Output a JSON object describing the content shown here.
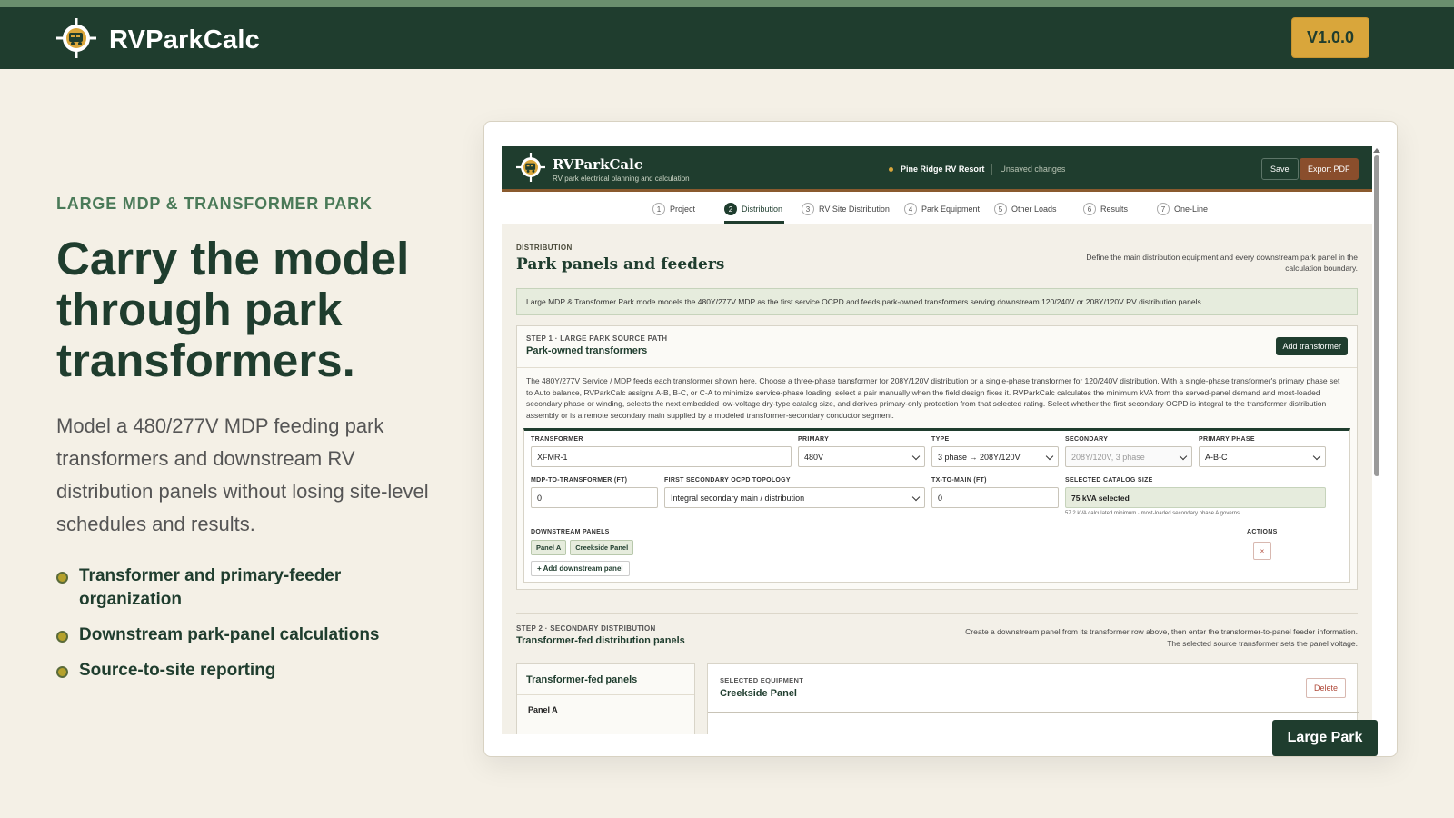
{
  "site": {
    "brand": "RVParkCalc",
    "version": "V1.0.0"
  },
  "hero": {
    "eyebrow": "LARGE MDP & TRANSFORMER PARK",
    "headline": "Carry the model through park transformers.",
    "description": "Model a 480/277V MDP feeding park transformers and downstream RV distribution panels without losing site-level schedules and results.",
    "bullets": [
      "Transformer and primary-feeder organization",
      "Downstream park-panel calculations",
      "Source-to-site reporting"
    ]
  },
  "app": {
    "title": "RVParkCalc",
    "subtitle": "RV park electrical planning and calculation",
    "project_name": "Pine Ridge RV Resort",
    "project_status": "Unsaved changes",
    "save_label": "Save",
    "export_label": "Export PDF",
    "tabs": [
      {
        "num": "1",
        "label": "Project"
      },
      {
        "num": "2",
        "label": "Distribution"
      },
      {
        "num": "3",
        "label": "RV Site Distribution"
      },
      {
        "num": "4",
        "label": "Park Equipment"
      },
      {
        "num": "5",
        "label": "Other Loads"
      },
      {
        "num": "6",
        "label": "Results"
      },
      {
        "num": "7",
        "label": "One-Line"
      }
    ],
    "section": {
      "eyebrow": "DISTRIBUTION",
      "title": "Park panels and feeders",
      "description": "Define the main distribution equipment and every downstream park panel in the calculation boundary.",
      "notice": "Large MDP & Transformer Park mode models the 480Y/277V MDP as the first service OCPD and feeds park-owned transformers serving downstream 120/240V or 208Y/120V RV distribution panels."
    },
    "step1": {
      "eyebrow": "STEP 1 · LARGE PARK SOURCE PATH",
      "title": "Park-owned transformers",
      "add_label": "Add transformer",
      "body": "The 480Y/277V Service / MDP feeds each transformer shown here. Choose a three-phase transformer for 208Y/120V distribution or a single-phase transformer for 120/240V distribution. With a single-phase transformer's primary phase set to Auto balance, RVParkCalc assigns A-B, B-C, or C-A to minimize service-phase loading; select a pair manually when the field design fixes it. RVParkCalc calculates the minimum kVA from the served-panel demand and most-loaded secondary phase or winding, selects the next embedded low-voltage dry-type catalog size, and derives primary-only protection from that selected rating. Select whether the first secondary OCPD is integral to the transformer distribution assembly or is a remote secondary main supplied by a modeled transformer-secondary conductor segment.",
      "fields": {
        "transformer_label": "TRANSFORMER",
        "transformer_value": "XFMR-1",
        "primary_label": "PRIMARY",
        "primary_value": "480V",
        "type_label": "TYPE",
        "type_value": "3 phase → 208Y/120V",
        "secondary_label": "SECONDARY",
        "secondary_value": "208Y/120V, 3 phase",
        "phase_label": "PRIMARY PHASE",
        "phase_value": "A-B-C",
        "mdp_label": "MDP-TO-TRANSFORMER (FT)",
        "mdp_value": "0",
        "topology_label": "FIRST SECONDARY OCPD TOPOLOGY",
        "topology_value": "Integral secondary main / distribution",
        "txmain_label": "TX-TO-MAIN (FT)",
        "txmain_value": "0",
        "catalog_label": "SELECTED CATALOG SIZE",
        "catalog_value": "75 kVA selected",
        "catalog_hint": "57.2 kVA calculated minimum · most-loaded secondary phase A governs",
        "downstream_label": "DOWNSTREAM PANELS",
        "downstream_panels": [
          "Panel A",
          "Creekside Panel"
        ],
        "add_panel_label": "+ Add downstream panel",
        "actions_label": "ACTIONS",
        "remove_glyph": "×"
      }
    },
    "step2": {
      "eyebrow": "STEP 2 · SECONDARY DISTRIBUTION",
      "title": "Transformer-fed distribution panels",
      "description": "Create a downstream panel from its transformer row above, then enter the transformer-to-panel feeder information. The selected source transformer sets the panel voltage.",
      "panels_title": "Transformer-fed panels",
      "first_panel": "Panel A",
      "selected_eyebrow": "SELECTED EQUIPMENT",
      "selected_title": "Creekside Panel",
      "delete_label": "Delete"
    }
  },
  "corner_badge": "Large Park",
  "colors": {
    "primary": "#1f3d2e",
    "accent": "#d9a63b",
    "background": "#f4f0e6",
    "export": "#8a4e2c"
  }
}
